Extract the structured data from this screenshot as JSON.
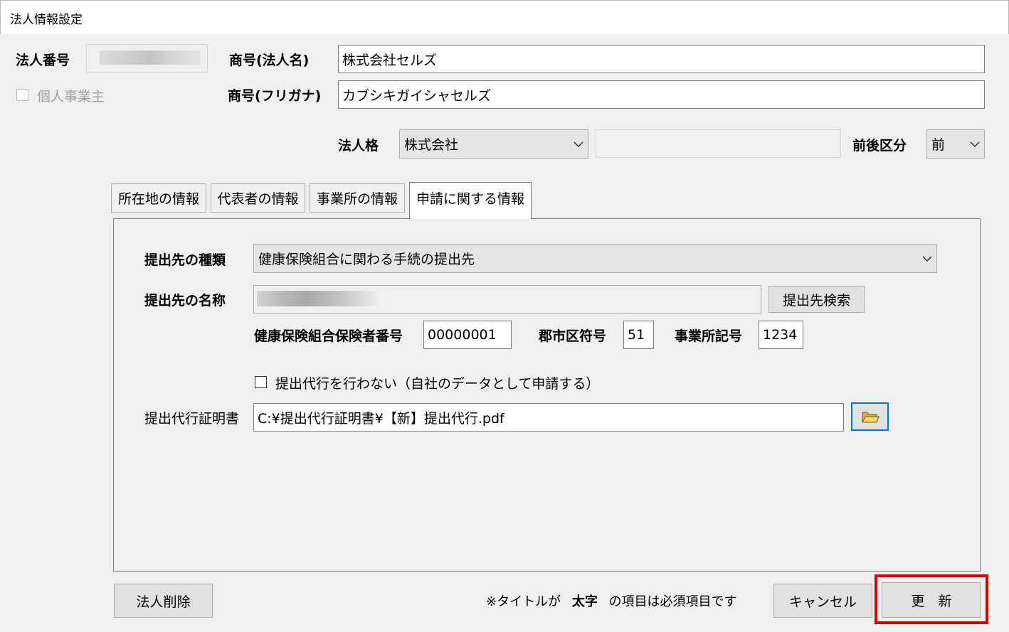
{
  "window": {
    "title": "法人情報設定"
  },
  "corp": {
    "number_label": "法人番号",
    "sole_prop_label": "個人事業主",
    "name_label": "商号(法人名)",
    "name_value": "株式会社セルズ",
    "kana_label": "商号(フリガナ)",
    "kana_value": "カブシキガイシャセルズ",
    "type_label": "法人格",
    "type_value": "株式会社",
    "position_label": "前後区分",
    "position_value": "前"
  },
  "tabs": [
    {
      "label": "所在地の情報"
    },
    {
      "label": "代表者の情報"
    },
    {
      "label": "事業所の情報"
    },
    {
      "label": "申請に関する情報"
    }
  ],
  "application": {
    "dest_type_label": "提出先の種類",
    "dest_type_value": "健康保険組合に関わる手続の提出先",
    "dest_name_label": "提出先の名称",
    "search_button": "提出先検索",
    "insurer_label": "健康保険組合保険者番号",
    "insurer_value": "00000001",
    "city_label": "郡市区符号",
    "city_value": "51",
    "office_label": "事業所記号",
    "office_value": "1234",
    "no_proxy_label": "提出代行を行わない（自社のデータとして申請する）",
    "cert_label": "提出代行証明書",
    "cert_value": "C:¥提出代行証明書¥【新】提出代行.pdf"
  },
  "footer": {
    "delete_button": "法人削除",
    "note_prefix": "※タイトルが",
    "note_bold": "太字",
    "note_suffix": "の項目は必須項目です",
    "cancel_button": "キャンセル",
    "update_button": "更　新"
  },
  "colors": {
    "highlight": "#d40000",
    "folder": "#e8c640"
  },
  "icons": {
    "folder": "folder-icon",
    "chevron": "chevron-down-icon"
  }
}
